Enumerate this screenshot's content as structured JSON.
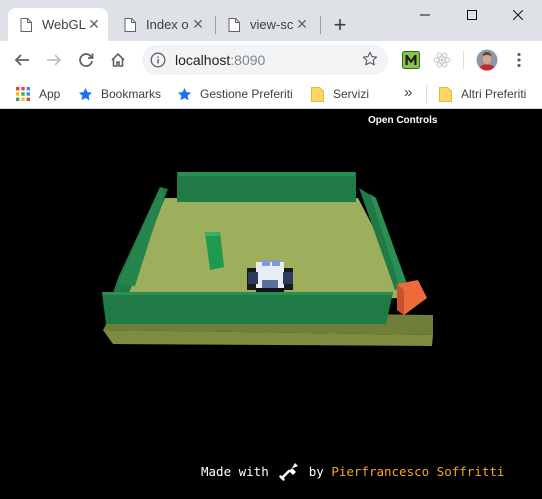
{
  "browser": {
    "tabs": [
      {
        "title": "WebGL",
        "active": true
      },
      {
        "title": "Index o",
        "active": false
      },
      {
        "title": "view-sc",
        "active": false
      }
    ],
    "new_tab_glyph": "+",
    "window_controls": [
      "minimize-icon",
      "maximize-icon",
      "close-icon"
    ],
    "nav": {
      "back_icon": "arrow-left-icon",
      "forward_icon": "arrow-right-icon",
      "reload_icon": "reload-icon",
      "home_icon": "home-icon"
    },
    "address": {
      "host": "localhost",
      "port": ":8090",
      "info_icon": "info-icon",
      "bookmark_icon": "star-icon"
    },
    "extensions": [
      "m-extension-icon",
      "react-devtools-icon"
    ],
    "profile_icon": "avatar",
    "menu_icon": "kebab-menu-icon",
    "bookmarks": [
      {
        "label": "App",
        "icon": "apps-grid-icon"
      },
      {
        "label": "Bookmarks",
        "icon": "star-icon"
      },
      {
        "label": "Gestione Preferiti",
        "icon": "star-icon"
      },
      {
        "label": "Servizi",
        "icon": "folder-icon"
      }
    ],
    "bookmarks_overflow": "»",
    "other_bookmarks": {
      "label": "Altri Preferiti",
      "icon": "folder-icon"
    }
  },
  "app": {
    "open_controls": "Open Controls",
    "credit": {
      "made_with": "Made with",
      "by": "by",
      "author": "Pierfrancesco Soffritti",
      "tool_icon": "shovel-icon"
    },
    "colors": {
      "floor": "#9dae5d",
      "wall": "#1f7a45",
      "obstacle_cube": "#ee6a3a",
      "pillar": "#1d9a4f",
      "author_text": "#f5a623"
    }
  }
}
